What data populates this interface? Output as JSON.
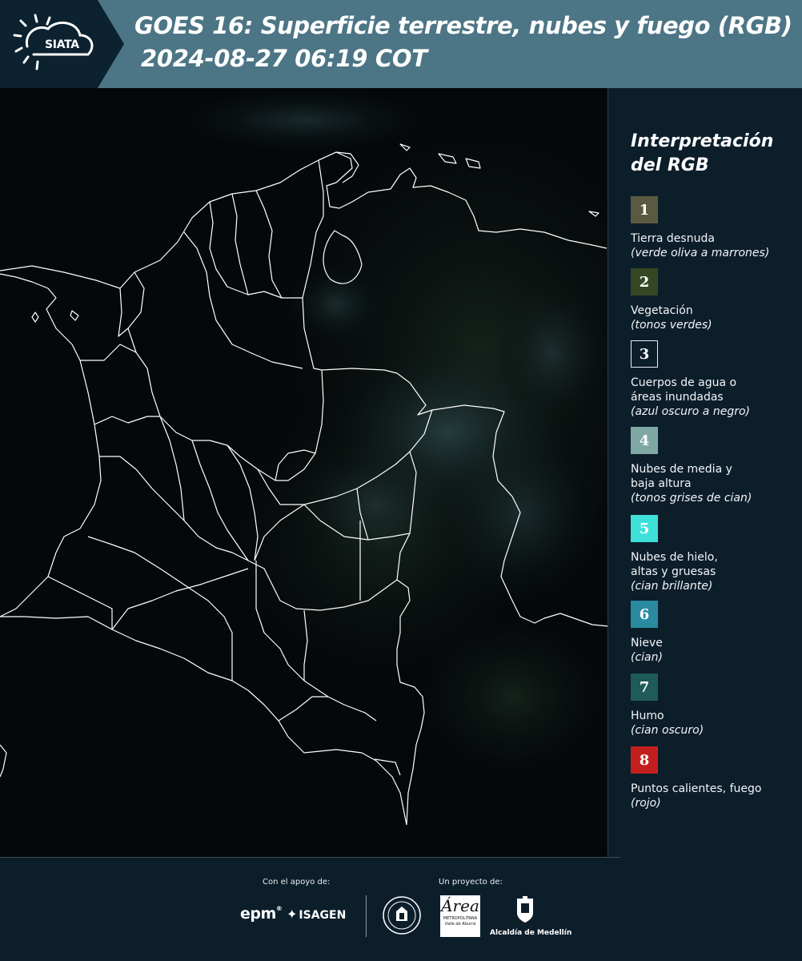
{
  "header": {
    "logo_text": "SIATA",
    "title": "GOES 16: Superficie terrestre, nubes y fuego (RGB)",
    "subtitle": "2024-08-27 06:19 COT"
  },
  "legend": {
    "title": "Interpretación del RGB",
    "items": [
      {
        "num": "1",
        "color": "#5a5a40",
        "label": "Tierra desnuda",
        "desc": "(verde oliva a marrones)"
      },
      {
        "num": "2",
        "color": "#354723",
        "label": "Vegetación",
        "desc": "(tonos verdes)"
      },
      {
        "num": "3",
        "color": "#0d1e2b",
        "label": "Cuerpos de agua o\náreas inundadas",
        "desc": "(azul oscuro a negro)"
      },
      {
        "num": "4",
        "color": "#7fa8a4",
        "label": "Nubes de media y\nbaja altura",
        "desc": "(tonos grises de cian)"
      },
      {
        "num": "5",
        "color": "#3fe0d8",
        "label": "Nubes de hielo,\naltas y gruesas",
        "desc": "(cian brillante)"
      },
      {
        "num": "6",
        "color": "#2a8aa0",
        "label": "Nieve",
        "desc": "(cian)"
      },
      {
        "num": "7",
        "color": "#205a5a",
        "label": "Humo",
        "desc": "(cian oscuro)"
      },
      {
        "num": "8",
        "color": "#c41f1f",
        "label": "Puntos calientes, fuego",
        "desc": "(rojo)"
      }
    ]
  },
  "footer": {
    "support_label": "Con el apoyo de:",
    "project_label": "Un proyecto de:",
    "epm": "epm",
    "isagen": "ISAGEN",
    "area_metro_line1": "METROPOLITANA",
    "area_metro_line2": "Valle de Aburrá",
    "alcaldia": "Alcaldía de Medellín"
  }
}
